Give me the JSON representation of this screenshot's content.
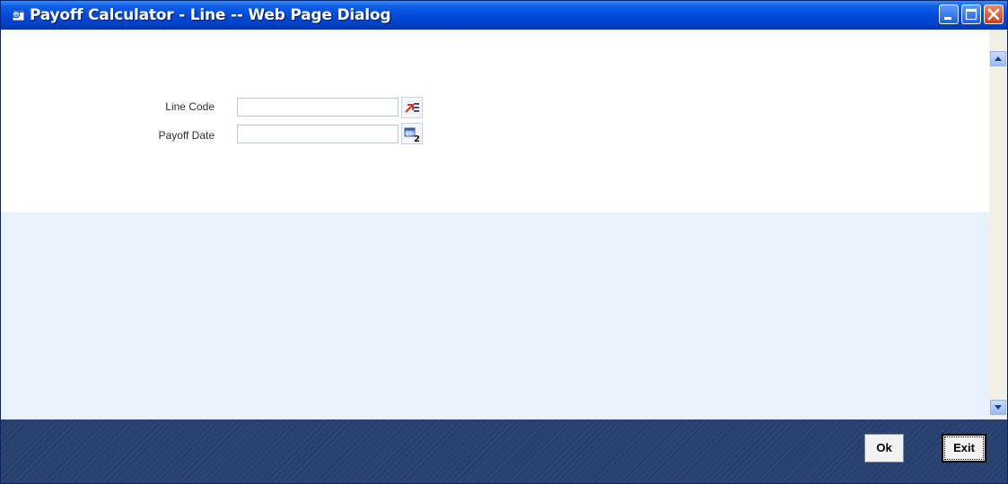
{
  "window": {
    "title": "Payoff Calculator - Line -- Web Page Dialog"
  },
  "form": {
    "line_code": {
      "label": "Line Code",
      "value": ""
    },
    "payoff_date": {
      "label": "Payoff Date",
      "value": ""
    }
  },
  "footer": {
    "ok_label": "Ok",
    "exit_label": "Exit"
  },
  "colors": {
    "titlebar": "#0048d8",
    "footer": "#27406f",
    "lower_panel": "#e8f1fc"
  },
  "icons": [
    "window-icon",
    "minimize-icon",
    "maximize-icon",
    "close-icon",
    "list-of-values-icon",
    "calendar-icon",
    "scroll-up-icon",
    "scroll-down-icon"
  ]
}
